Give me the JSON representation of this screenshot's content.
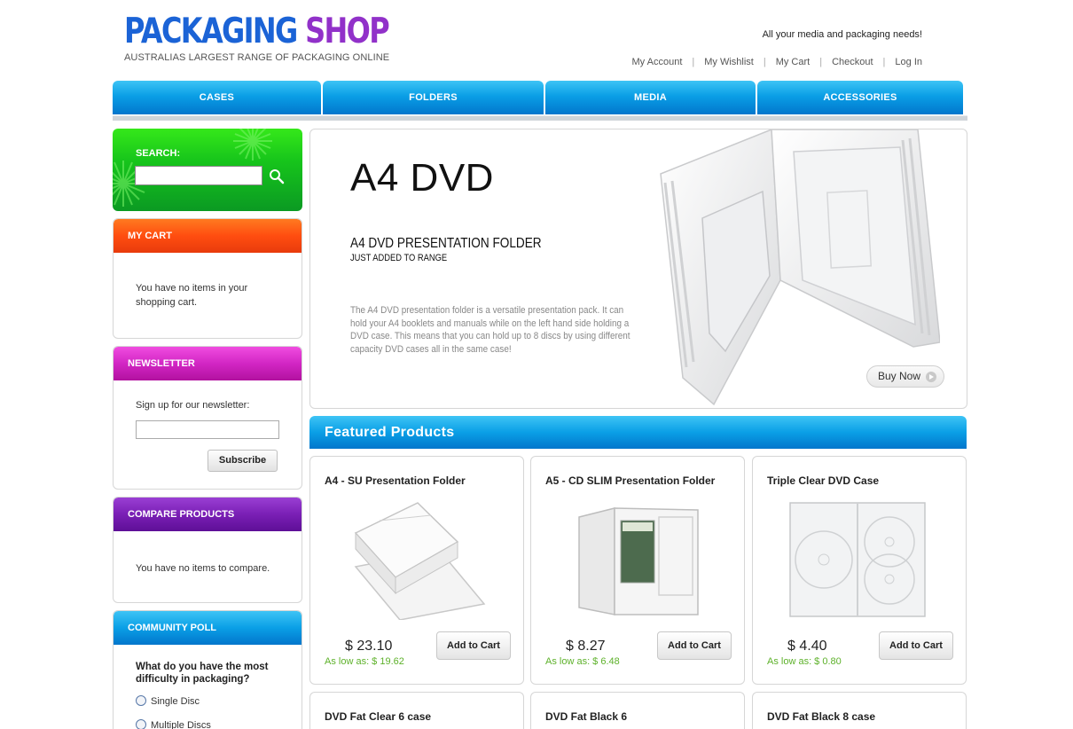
{
  "header": {
    "logo_word1": "PACKAGING",
    "logo_word2": "SHOP",
    "logo_sub": "AUSTRALIAS LARGEST RANGE OF PACKAGING ONLINE",
    "tagline": "All your media and packaging needs!",
    "links": [
      "My Account",
      "My Wishlist",
      "My Cart",
      "Checkout",
      "Log In"
    ]
  },
  "nav": {
    "tabs": [
      "CASES",
      "FOLDERS",
      "MEDIA",
      "ACCESSORIES"
    ]
  },
  "sidebar": {
    "search": {
      "label": "SEARCH:",
      "value": ""
    },
    "cart": {
      "title": "MY CART",
      "text": "You have no items in your shopping cart."
    },
    "newsletter": {
      "title": "NEWSLETTER",
      "label": "Sign up for our newsletter:",
      "button": "Subscribe",
      "value": ""
    },
    "compare": {
      "title": "COMPARE PRODUCTS",
      "text": "You have no items to compare."
    },
    "poll": {
      "title": "COMMUNITY POLL",
      "question": "What do you have the most difficulty in packaging?",
      "options": [
        "Single Disc",
        "Multiple Discs"
      ]
    }
  },
  "hero": {
    "title": "A4 DVD",
    "subtitle": "A4 DVD PRESENTATION FOLDER",
    "subtitle2": "JUST ADDED TO RANGE",
    "description": "The A4 DVD presentation folder is a versatile presentation pack. It can hold your A4 booklets and manuals while on the left hand side holding a DVD case. This means that you can hold up to 8 discs by using different capacity DVD cases all in the same case!",
    "button": "Buy Now"
  },
  "featured": {
    "title": "Featured Products",
    "products": [
      {
        "name": "A4 - SU Presentation Folder",
        "price": "$ 23.10",
        "as_low": "As low as: $ 19.62",
        "button": "Add to Cart"
      },
      {
        "name": "A5 - CD SLIM Presentation Folder",
        "price": "$ 8.27",
        "as_low": "As low as: $ 6.48",
        "button": "Add to Cart"
      },
      {
        "name": "Triple Clear DVD Case",
        "price": "$ 4.40",
        "as_low": "As low as: $ 0.80",
        "button": "Add to Cart"
      }
    ],
    "more": [
      {
        "name": "DVD Fat Clear 6 case"
      },
      {
        "name": "DVD Fat Black 6"
      },
      {
        "name": "DVD Fat Black 8 case"
      }
    ]
  },
  "colors": {
    "nav_blue": "#0a9fe6",
    "search_green": "#16c41b",
    "cart_orange": "#ff5a10",
    "newsletter_magenta": "#d226c4",
    "compare_purple": "#7a1fb5",
    "price_green": "#5db12a"
  }
}
